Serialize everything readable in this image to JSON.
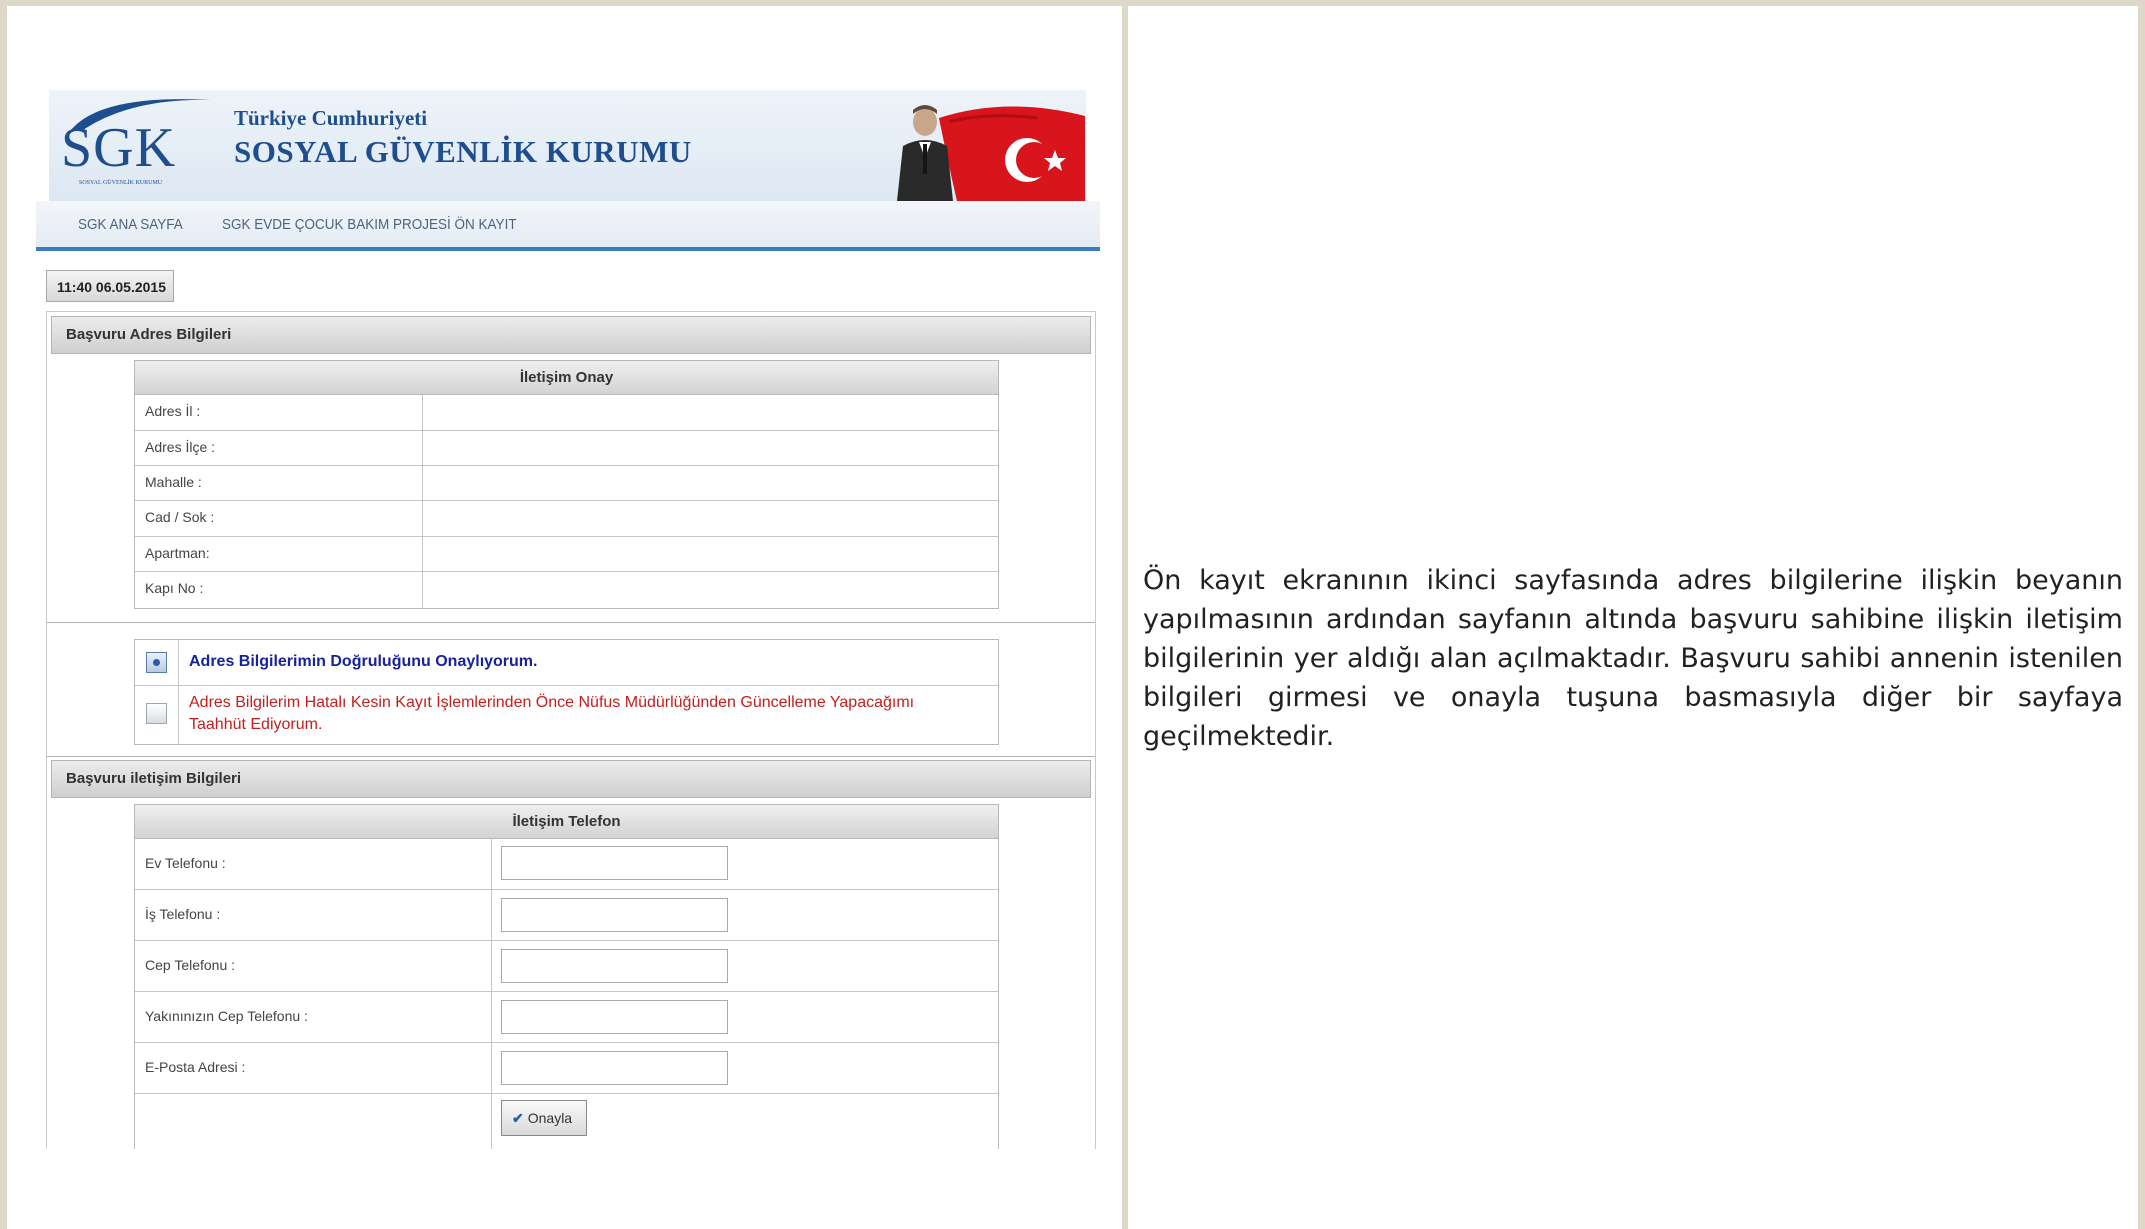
{
  "header": {
    "logo_text": "SGK",
    "logo_subtext": "SOSYAL GÜVENLİK KURUMU",
    "org_title": "Türkiye Cumhuriyeti",
    "org_name": "SOSYAL GÜVENLİK KURUMU",
    "brand_color": "#1f4e8f"
  },
  "nav": {
    "items": [
      {
        "label": "SGK ANA SAYFA"
      },
      {
        "label": "SGK EVDE ÇOCUK BAKIM PROJESİ ÖN KAYIT"
      }
    ]
  },
  "timestamp": "11:40 06.05.2015",
  "address_section": {
    "title": "Başvuru Adres Bilgileri",
    "table_title": "İletişim Onay",
    "rows": [
      {
        "label": "Adres İl :"
      },
      {
        "label": "Adres İlçe :"
      },
      {
        "label": "Mahalle :"
      },
      {
        "label": "Cad / Sok :"
      },
      {
        "label": "Apartman:"
      },
      {
        "label": "Kapı No :"
      }
    ]
  },
  "confirmations": {
    "confirm_label": "Adres Bilgilerimin Doğruluğunu Onaylıyorum.",
    "confirm_selected": true,
    "undertaking_label": "Adres Bilgilerim Hatalı Kesin Kayıt İşlemlerinden Önce Nüfus Müdürlüğünden Güncelleme Yapacağımı Taahhüt Ediyorum.",
    "undertaking_selected": false
  },
  "contact_section": {
    "title": "Başvuru iletişim Bilgileri",
    "table_title": "İletişim Telefon",
    "fields": [
      {
        "label": "Ev Telefonu :",
        "value": ""
      },
      {
        "label": "İş Telefonu :",
        "value": ""
      },
      {
        "label": "Cep Telefonu :",
        "value": ""
      },
      {
        "label": "Yakınınızın Cep Telefonu :",
        "value": ""
      },
      {
        "label": "E-Posta Adresi :",
        "value": ""
      }
    ],
    "submit_label": "Onayla"
  },
  "description": "Ön kayıt ekranının ikinci sayfasında adres bilgilerine ilişkin beyanın yapılmasının ardından sayfanın altında başvuru sahibine ilişkin iletişim bilgilerinin yer aldığı alan açılmaktadır. Başvuru sahibi annenin istenilen bilgileri girmesi ve onayla tuşuna basmasıyla diğer bir sayfaya geçilmektedir.",
  "colors": {
    "frame": "#ddd8c8",
    "nav_underline": "#3b7bbf",
    "confirm_text": "#17239a",
    "warning_text": "#c41e1e"
  }
}
